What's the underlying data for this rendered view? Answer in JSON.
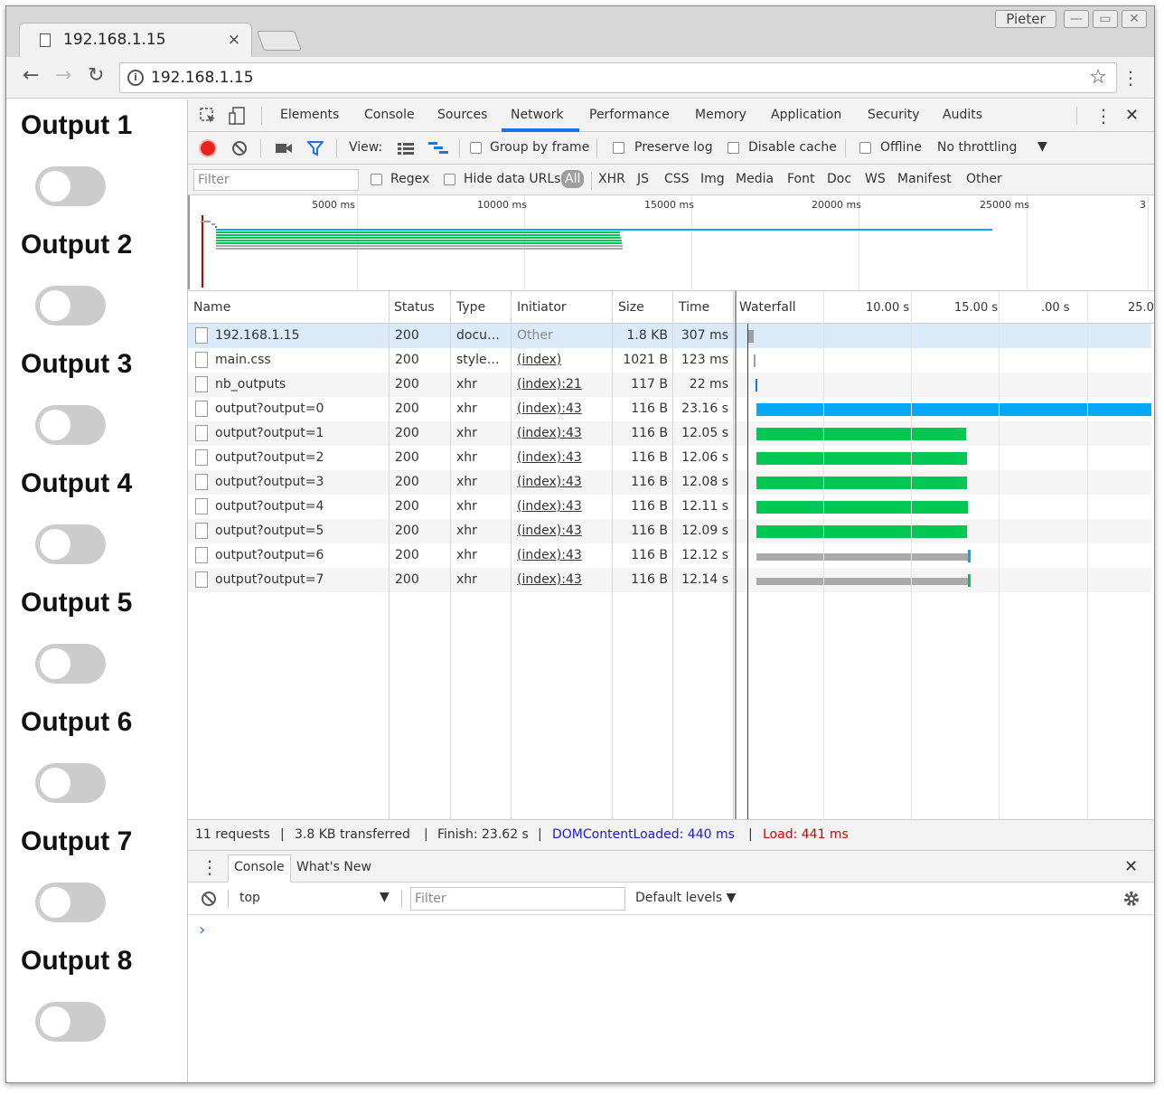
{
  "browser": {
    "tab_title": "192.168.1.15",
    "tab_close": "×",
    "user_name": "Pieter",
    "url": "192.168.1.15",
    "info_icon": "i",
    "star_icon": "☆",
    "back_icon": "←",
    "forward_icon": "→",
    "reload_icon": "↻",
    "kebab_icon": "⋮",
    "minimize": "—",
    "restore": "▭",
    "close": "✕"
  },
  "page": {
    "outputs": [
      {
        "label": "Output 1",
        "on": false
      },
      {
        "label": "Output 2",
        "on": false
      },
      {
        "label": "Output 3",
        "on": false
      },
      {
        "label": "Output 4",
        "on": false
      },
      {
        "label": "Output 5",
        "on": false
      },
      {
        "label": "Output 6",
        "on": false
      },
      {
        "label": "Output 7",
        "on": false
      },
      {
        "label": "Output 8",
        "on": false
      }
    ]
  },
  "devtools": {
    "tabs": [
      "Elements",
      "Console",
      "Sources",
      "Network",
      "Performance",
      "Memory",
      "Application",
      "Security",
      "Audits"
    ],
    "active_tab": "Network",
    "close_icon": "✕",
    "view_label": "View:",
    "group_by_frame": "Group by frame",
    "preserve_log": "Preserve log",
    "disable_cache": "Disable cache",
    "offline": "Offline",
    "throttling": "No throttling",
    "filter_placeholder": "Filter",
    "regex": "Regex",
    "hide_data_urls": "Hide data URLs",
    "type_filters": [
      "All",
      "XHR",
      "JS",
      "CSS",
      "Img",
      "Media",
      "Font",
      "Doc",
      "WS",
      "Manifest",
      "Other"
    ],
    "overview_ticks": [
      "5000 ms",
      "10000 ms",
      "15000 ms",
      "20000 ms",
      "25000 ms",
      "3"
    ],
    "columns": [
      "Name",
      "Status",
      "Type",
      "Initiator",
      "Size",
      "Time",
      "Waterfall"
    ],
    "waterfall_ticks": [
      "10.00 s",
      "15.00 s",
      ".00 s",
      "25.0"
    ],
    "requests": [
      {
        "name": "192.168.1.15",
        "status": "200",
        "type": "docu…",
        "initiator": "Other",
        "size": "1.8 KB",
        "time": "307 ms",
        "start_s": 0.0,
        "duration_s": 0.307,
        "bar_color": "#9aa0a6"
      },
      {
        "name": "main.css",
        "status": "200",
        "type": "style…",
        "initiator": "(index)",
        "size": "1021 B",
        "time": "123 ms",
        "start_s": 0.31,
        "duration_s": 0.123,
        "bar_color": "#9aa0a6"
      },
      {
        "name": "nb_outputs",
        "status": "200",
        "type": "xhr",
        "initiator": "(index):21",
        "size": "117 B",
        "time": "22 ms",
        "start_s": 0.44,
        "duration_s": 0.022,
        "bar_color": "#1a73e8"
      },
      {
        "name": "output?output=0",
        "status": "200",
        "type": "xhr",
        "initiator": "(index):43",
        "size": "116 B",
        "time": "23.16 s",
        "start_s": 0.46,
        "duration_s": 23.16,
        "bar_color": "#03a9f4"
      },
      {
        "name": "output?output=1",
        "status": "200",
        "type": "xhr",
        "initiator": "(index):43",
        "size": "116 B",
        "time": "12.05 s",
        "start_s": 0.46,
        "duration_s": 12.05,
        "bar_color": "#00c853"
      },
      {
        "name": "output?output=2",
        "status": "200",
        "type": "xhr",
        "initiator": "(index):43",
        "size": "116 B",
        "time": "12.06 s",
        "start_s": 0.46,
        "duration_s": 12.06,
        "bar_color": "#00c853"
      },
      {
        "name": "output?output=3",
        "status": "200",
        "type": "xhr",
        "initiator": "(index):43",
        "size": "116 B",
        "time": "12.08 s",
        "start_s": 0.46,
        "duration_s": 12.08,
        "bar_color": "#00c853"
      },
      {
        "name": "output?output=4",
        "status": "200",
        "type": "xhr",
        "initiator": "(index):43",
        "size": "116 B",
        "time": "12.11 s",
        "start_s": 0.46,
        "duration_s": 12.11,
        "bar_color": "#00c853"
      },
      {
        "name": "output?output=5",
        "status": "200",
        "type": "xhr",
        "initiator": "(index):43",
        "size": "116 B",
        "time": "12.09 s",
        "start_s": 0.46,
        "duration_s": 12.09,
        "bar_color": "#00c853"
      },
      {
        "name": "output?output=6",
        "status": "200",
        "type": "xhr",
        "initiator": "(index):43",
        "size": "116 B",
        "time": "12.12 s",
        "start_s": 0.46,
        "duration_s": 12.12,
        "bar_color": "#aaaaaa"
      },
      {
        "name": "output?output=7",
        "status": "200",
        "type": "xhr",
        "initiator": "(index):43",
        "size": "116 B",
        "time": "12.14 s",
        "start_s": 0.46,
        "duration_s": 12.14,
        "bar_color": "#aaaaaa"
      }
    ],
    "summary": {
      "requests": "11 requests",
      "transferred": "3.8 KB transferred",
      "finish": "Finish: 23.62 s",
      "dom_content_loaded": "DOMContentLoaded: 440 ms",
      "load": "Load: 441 ms",
      "separator": "|"
    },
    "drawer": {
      "tabs": [
        "Console",
        "What's New"
      ],
      "context": "top",
      "filter_placeholder": "Filter",
      "levels": "Default levels ▼",
      "prompt": "›"
    },
    "colors": {
      "record": "#e8231c",
      "dom_content_loaded": "#1a1adf",
      "load": "#d60000",
      "active_tab_underline": "#1a73e8",
      "selected_row": "#dbeaf9",
      "alt_row": "#f5f5f5"
    }
  }
}
